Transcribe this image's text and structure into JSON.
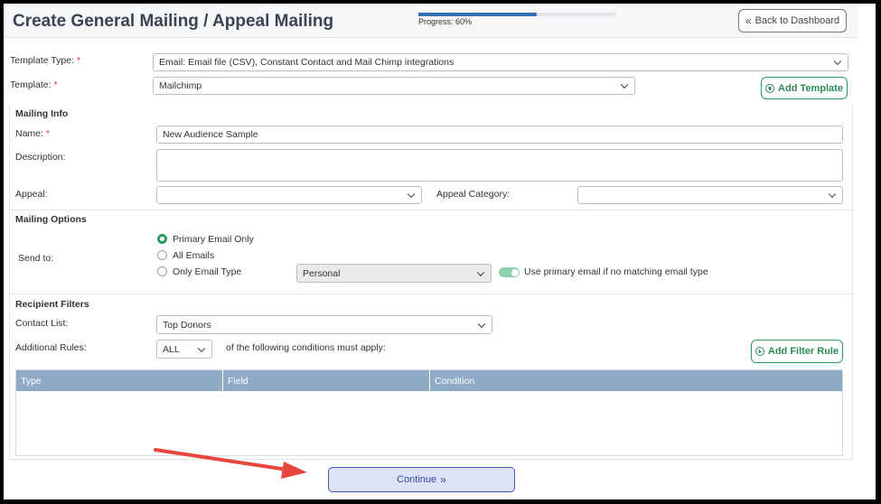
{
  "header": {
    "title": "Create General Mailing / Appeal Mailing",
    "progress_label": "Progress: 60%",
    "progress_value": 0.6,
    "back_label": "Back to Dashboard"
  },
  "template_section": {
    "template_type_label": "Template Type:",
    "template_type_value": "Email: Email file (CSV), Constant Contact and Mail Chimp integrations",
    "template_label": "Template:",
    "template_value": "Mailchimp",
    "add_template_label": "Add Template"
  },
  "mailing_info": {
    "title": "Mailing Info",
    "name_label": "Name:",
    "name_value": "New Audience Sample",
    "description_label": "Description:",
    "description_value": "",
    "appeal_label": "Appeal:",
    "appeal_value": "",
    "appeal_category_label": "Appeal Category:",
    "appeal_category_value": ""
  },
  "mailing_options": {
    "title": "Mailing Options",
    "send_to_label": "Send to:",
    "options": [
      "Primary Email Only",
      "All Emails",
      "Only Email Type"
    ],
    "selected_option": "Primary Email Only",
    "email_type_value": "Personal",
    "toggle_label": "Use primary email if no matching email type",
    "toggle_on": true
  },
  "recipient_filters": {
    "title": "Recipient Filters",
    "contact_list_label": "Contact List:",
    "contact_list_value": "Top Donors",
    "additional_rules_label": "Additional Rules:",
    "rules_match_value": "ALL",
    "rules_suffix": "of the following conditions must apply:",
    "add_filter_label": "Add Filter Rule",
    "columns": [
      "Type",
      "Field",
      "Condition"
    ]
  },
  "footer": {
    "continue_label": "Continue"
  },
  "colors": {
    "accent_green": "#2e9a63",
    "progress_blue": "#2f6db5",
    "table_header": "#8faac6",
    "continue_bg": "#dde2f7",
    "annotation_arrow": "#e8453c"
  }
}
